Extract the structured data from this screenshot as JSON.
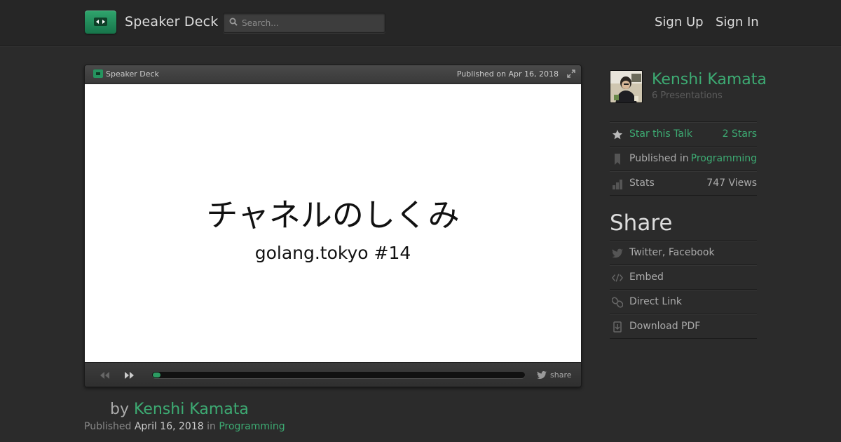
{
  "header": {
    "brand": "Speaker Deck",
    "search_placeholder": "Search...",
    "sign_up": "Sign Up",
    "sign_in": "Sign In"
  },
  "player": {
    "brand": "Speaker Deck",
    "published": "Published on Apr 16, 2018",
    "slide_title": "チャネルのしくみ",
    "slide_subtitle": "golang.tokyo #14",
    "progress": 0.02,
    "share_label": "share"
  },
  "byline": {
    "by": "by",
    "author": "Kenshi Kamata",
    "published_label": "Published",
    "date": "April 16, 2018",
    "in_label": "in",
    "category": "Programming"
  },
  "sidebar": {
    "author": "Kenshi Kamata",
    "presentations": "6 Presentations",
    "star_label": "Star this Talk",
    "stars": "2 Stars",
    "published_in_label": "Published in",
    "category": "Programming",
    "stats_label": "Stats",
    "views": "747 Views",
    "share_title": "Share",
    "share_items": [
      "Twitter, Facebook",
      "Embed",
      "Direct Link",
      "Download PDF"
    ]
  },
  "colors": {
    "accent": "#3dab73",
    "background": "#2b2b2b"
  },
  "icons": [
    "search-icon",
    "expand-icon",
    "prev-icon",
    "next-icon",
    "twitter-bird-icon",
    "star-icon",
    "bookmark-icon",
    "bar-chart-icon",
    "link-icon",
    "code-icon",
    "chain-icon",
    "download-icon"
  ]
}
